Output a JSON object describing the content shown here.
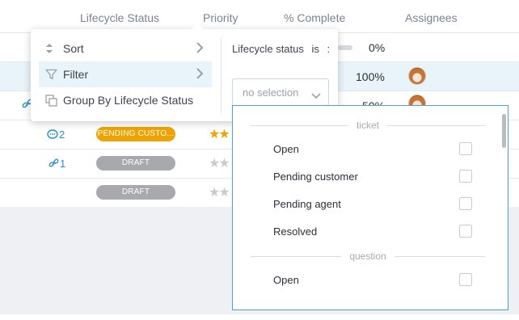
{
  "table": {
    "columns": [
      "Lifecycle Status",
      "Priority",
      "% Complete",
      "Assignees"
    ],
    "rows": [
      {
        "complete": "0%"
      },
      {
        "complete": "100%"
      },
      {
        "complete": "50%"
      },
      {
        "comments": "2",
        "status": "PENDING CUSTO...",
        "status_color": "#f0a300",
        "stars_filled": 2
      },
      {
        "links": "1",
        "status": "DRAFT",
        "status_color": "#a7a9ad",
        "stars_filled": 0
      },
      {
        "status": "DRAFT",
        "status_color": "#a7a9ad",
        "stars_filled": 0
      }
    ]
  },
  "menu": {
    "items": [
      {
        "label": "Sort",
        "icon": "sort-icon",
        "has_submenu": true
      },
      {
        "label": "Filter",
        "icon": "filter-icon",
        "has_submenu": true,
        "active": true
      },
      {
        "label": "Group By Lifecycle Status",
        "icon": "group-icon",
        "has_submenu": false
      }
    ],
    "filter": {
      "field": "Lifecycle status",
      "operator": "is",
      "separator": ":",
      "select_value": "no selection"
    }
  },
  "dropdown": {
    "groups": [
      {
        "name": "ticket",
        "options": [
          "Open",
          "Pending customer",
          "Pending agent",
          "Resolved"
        ]
      },
      {
        "name": "question",
        "options": [
          "Open"
        ]
      }
    ]
  },
  "colors": {
    "accent": "#4aa3d6",
    "link": "#2a90c8",
    "orange": "#f0a300"
  }
}
